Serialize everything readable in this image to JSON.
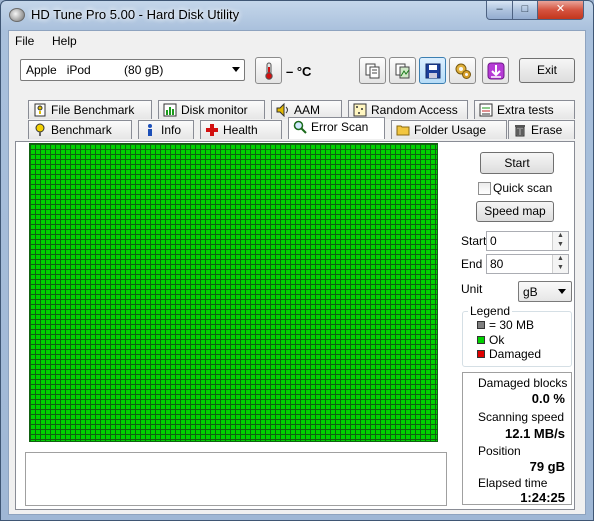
{
  "window": {
    "title": "HD Tune Pro 5.00 - Hard Disk Utility",
    "controls": {
      "minimize": "–",
      "maximize": "□",
      "close": "✕"
    }
  },
  "menu": {
    "file": "File",
    "help": "Help"
  },
  "toolbar": {
    "drive": "Apple   iPod          (80 gB)",
    "temperature": "– °C",
    "exit_label": "Exit",
    "icons": [
      "thermometer-icon",
      "copy-text-icon",
      "copy-screenshot-icon",
      "save-icon",
      "options-icon",
      "download-icon"
    ]
  },
  "tabs": {
    "row1": [
      "File Benchmark",
      "Disk monitor",
      "AAM",
      "Random Access",
      "Extra tests"
    ],
    "row2": [
      "Benchmark",
      "Info",
      "Health",
      "Error Scan",
      "Folder Usage",
      "Erase"
    ],
    "selected": "Error Scan"
  },
  "scan": {
    "start_label": "Start",
    "quick_scan_label": "Quick scan",
    "quick_scan_checked": false,
    "speed_map_label": "Speed map",
    "start_field_label": "Start",
    "start_value": "0",
    "end_field_label": "End",
    "end_value": "80",
    "unit_label": "Unit",
    "unit_value": "gB",
    "block_fill_percent_ok": 100
  },
  "legend": {
    "title": "Legend",
    "block_size": "= 30 MB",
    "ok": "Ok",
    "damaged": "Damaged",
    "colors": {
      "block": "#7f7f7f",
      "ok": "#00d200",
      "damaged": "#e00000"
    }
  },
  "stats": {
    "damaged_blocks_label": "Damaged blocks",
    "damaged_blocks_value": "0.0 %",
    "scanning_speed_label": "Scanning speed",
    "scanning_speed_value": "12.1 MB/s",
    "position_label": "Position",
    "position_value": "79 gB",
    "elapsed_time_label": "Elapsed time",
    "elapsed_time_value": "1:24:25"
  }
}
